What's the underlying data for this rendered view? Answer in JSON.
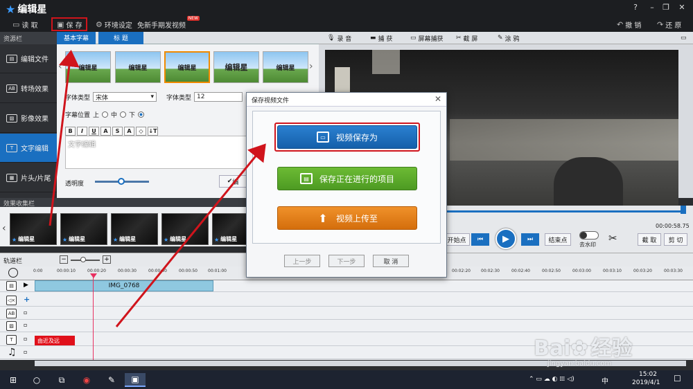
{
  "app": {
    "title": "编辑星",
    "win_controls": [
      "?",
      "–",
      "❐",
      "✕"
    ]
  },
  "menu": {
    "open": "读 取",
    "save": "保 存",
    "settings": "环境设定",
    "tutorial": "免新手期发视频",
    "new_badge": "NEW",
    "undo": "撤 销",
    "redo": "还 原"
  },
  "resources": {
    "header": "资源栏",
    "items": [
      {
        "label": "编辑文件",
        "icon": "film-icon"
      },
      {
        "label": "转场效果",
        "icon": "ab-icon"
      },
      {
        "label": "影像效果",
        "icon": "image-icon"
      },
      {
        "label": "文字编辑",
        "icon": "text-icon"
      },
      {
        "label": "片头/片尾",
        "icon": "grid-icon"
      }
    ]
  },
  "text_panel": {
    "tabs": [
      "基本字幕",
      "标 题"
    ],
    "thumbs": [
      "编辑星",
      "编辑星",
      "编辑星",
      "编辑星",
      "编辑星"
    ],
    "font_type_label": "字体类型",
    "font_value": "宋体",
    "font_size_label": "字体类型",
    "font_size_value": "12",
    "position_label": "字幕位置",
    "pos_top": "上",
    "pos_mid": "中",
    "pos_bottom": "下",
    "format_buttons": [
      "B",
      "I",
      "U",
      "A",
      "S",
      "A",
      "◇",
      "↓T"
    ],
    "edit_text": "文字编辑",
    "opacity_label": "透明度",
    "apply_label": "编"
  },
  "toolbar_right": {
    "record": "录 音",
    "capture": "捕 获",
    "screen": "屏幕捕获",
    "shot": "截 屏",
    "paint": "涂 鸦"
  },
  "controls": {
    "time": "00:00:58.75",
    "start": "开始点",
    "end": "结束点",
    "watermark": "去水印",
    "cut": "截 取",
    "clip": "剪 切"
  },
  "effects": {
    "header": "效果收集栏",
    "items": [
      "编辑星",
      "编辑星",
      "编辑星",
      "编辑星",
      "编辑星"
    ]
  },
  "timeline": {
    "header": "轨道栏",
    "ticks": [
      "0:00",
      "00:00:10",
      "00:00:20",
      "00:00:30",
      "00:00:40",
      "00:00:50",
      "00:01:00",
      "00:02:20",
      "00:02:30",
      "00:02:40",
      "00:02:50",
      "00:03:00",
      "00:03:10",
      "00:03:20",
      "00:03:30"
    ],
    "video_clip": "IMG_0768",
    "text_clip": "由近及远"
  },
  "dialog": {
    "title": "保存视频文件",
    "save_as": "视频保存为",
    "save_project": "保存正在进行的项目",
    "upload": "视频上传至",
    "prev": "上一步",
    "next": "下一步",
    "cancel": "取 消"
  },
  "taskbar": {
    "time": "15:02",
    "date": "2019/4/1",
    "ime": "中"
  },
  "watermark": {
    "brand": "Bai",
    "brand2": "经验",
    "url": "jingyan.baidu.com"
  },
  "colors": {
    "accent": "#1a6fc0",
    "annotation": "#d0141c",
    "save_as_btn": "#1a6fc0",
    "project_btn": "#57a12a",
    "upload_btn": "#e07c12"
  }
}
